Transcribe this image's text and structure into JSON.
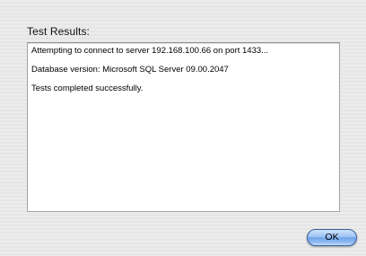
{
  "dialog": {
    "heading": "Test Results:",
    "results": [
      "Attempting to connect to server 192.168.100.66 on port 1433...",
      "Database version: Microsoft SQL Server 09.00.2047",
      "Tests completed successfully."
    ],
    "ok_label": "OK"
  }
}
